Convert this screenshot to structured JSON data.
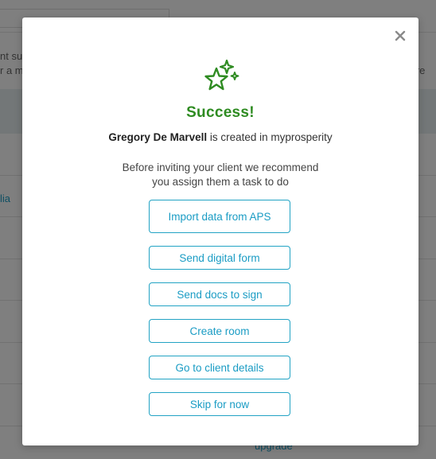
{
  "background": {
    "text_line_1": "nt su",
    "text_line_2": "r a m",
    "text_right": "ture",
    "link_left": "lia",
    "link_bottom": "upgrade"
  },
  "modal": {
    "close_label": "×",
    "title": "Success!",
    "client_name": "Gregory De Marvell",
    "created_suffix": " is created in myprosperity",
    "recommend_line_1": "Before inviting your client we recommend",
    "recommend_line_2": "you assign them a task to do",
    "buttons": {
      "import": "Import data from APS",
      "digital_form": "Send digital form",
      "docs_sign": "Send docs to sign",
      "create_room": "Create room",
      "client_details": "Go to client details",
      "skip": "Skip for now"
    },
    "colors": {
      "success": "#2e8b21",
      "accent": "#22a3c4",
      "overlay": "rgba(0,0,0,0.5)"
    },
    "icon": "sparkle-star-icon"
  }
}
